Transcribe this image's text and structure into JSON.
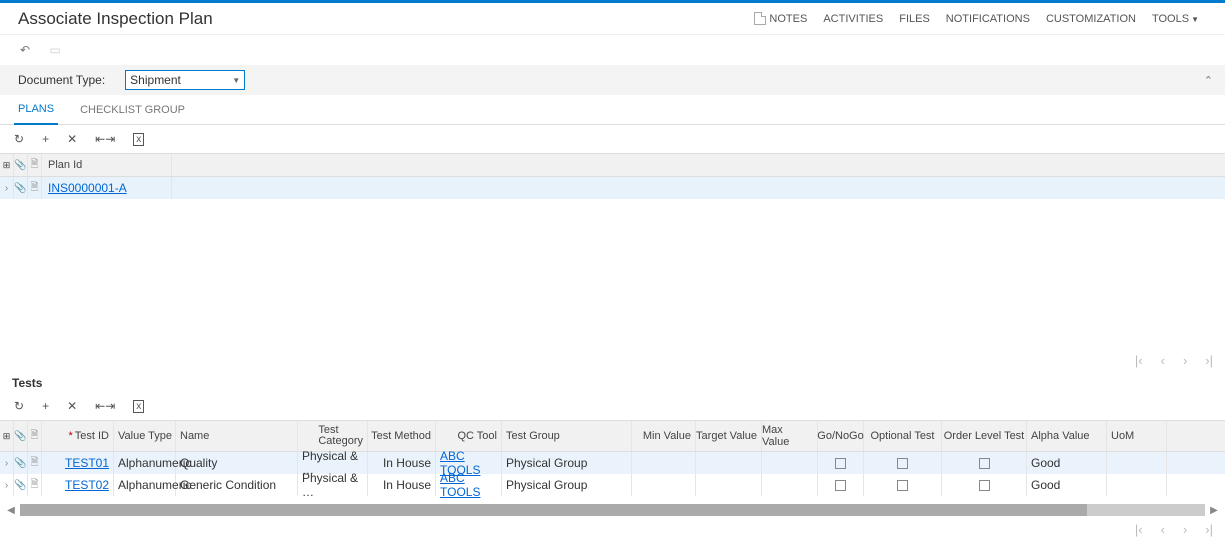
{
  "header": {
    "title": "Associate Inspection Plan",
    "links": {
      "notes": "NOTES",
      "activities": "ACTIVITIES",
      "files": "FILES",
      "notifications": "NOTIFICATIONS",
      "customization": "CUSTOMIZATION",
      "tools": "TOOLS"
    }
  },
  "filter": {
    "doc_type_label": "Document Type:",
    "doc_type_value": "Shipment"
  },
  "subtabs": {
    "plans": "PLANS",
    "checklist_group": "CHECKLIST GROUP"
  },
  "plans_grid": {
    "header": {
      "plan_id": "Plan Id"
    },
    "row": {
      "plan_id": "INS0000001-A"
    }
  },
  "tests_title": "Tests",
  "tests_header": {
    "test_id": "Test ID",
    "value_type": "Value Type",
    "name": "Name",
    "test_category_1": "Test",
    "test_category_2": "Category",
    "test_method": "Test Method",
    "qc_tool": "QC Tool",
    "test_group": "Test Group",
    "min_value": "Min Value",
    "target_value": "Target Value",
    "max_value": "Max Value",
    "gonogo": "Go/NoGo",
    "optional_test": "Optional Test",
    "order_level_test": "Order Level Test",
    "alpha_value": "Alpha Value",
    "uom": "UoM"
  },
  "tests_rows": {
    "r0": {
      "test_id": "TEST01",
      "value_type": "Alphanumeric",
      "name": "Quality",
      "category": "Physical & …",
      "method": "In House",
      "qc_tool": "ABC TOOLS",
      "group": "Physical Group",
      "alpha": "Good"
    },
    "r1": {
      "test_id": "TEST02",
      "value_type": "Alphanumeric",
      "name": "Generic Condition",
      "category": "Physical & …",
      "method": "In House",
      "qc_tool": "ABC TOOLS",
      "group": "Physical Group",
      "alpha": "Good"
    }
  }
}
